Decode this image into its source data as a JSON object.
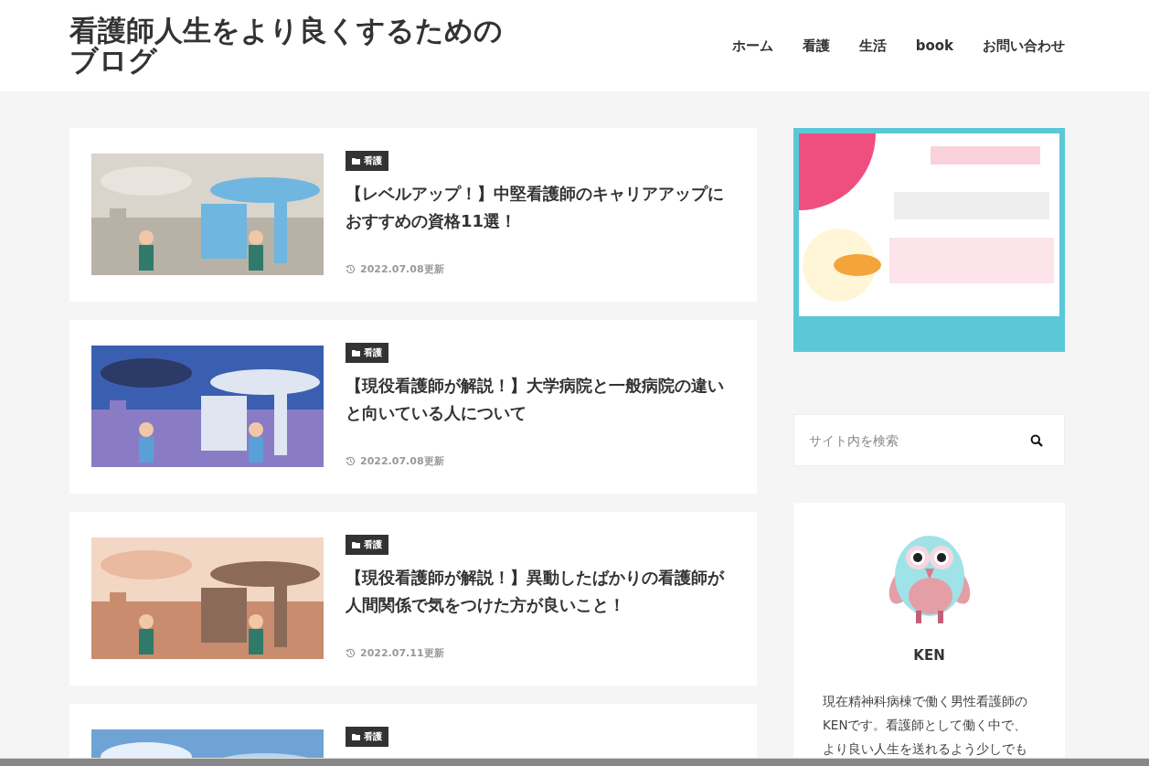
{
  "site_title": "看護師人生をより良くするためのブログ",
  "nav": [
    {
      "label": "ホーム"
    },
    {
      "label": "看護"
    },
    {
      "label": "生活"
    },
    {
      "label": "book"
    },
    {
      "label": "お問い合わせ"
    }
  ],
  "posts": [
    {
      "category": "看護",
      "title": "【レベルアップ！】中堅看護師のキャリアアップにおすすめの資格11選！",
      "date": "2022.07.08更新"
    },
    {
      "category": "看護",
      "title": "【現役看護師が解説！】大学病院と一般病院の違いと向いている人について",
      "date": "2022.07.08更新"
    },
    {
      "category": "看護",
      "title": "【現役看護師が解説！】異動したばかりの看護師が人間関係で気をつけた方が良いこと！",
      "date": "2022.07.11更新"
    },
    {
      "category": "看護"
    }
  ],
  "sidebar": {
    "search": {
      "placeholder": "サイト内を検索"
    },
    "profile": {
      "name": "KEN",
      "bio": "現在精神科病棟で働く男性看護師のKENです。看護師として働く中で、より良い人生を送れるよう少しでも"
    }
  }
}
